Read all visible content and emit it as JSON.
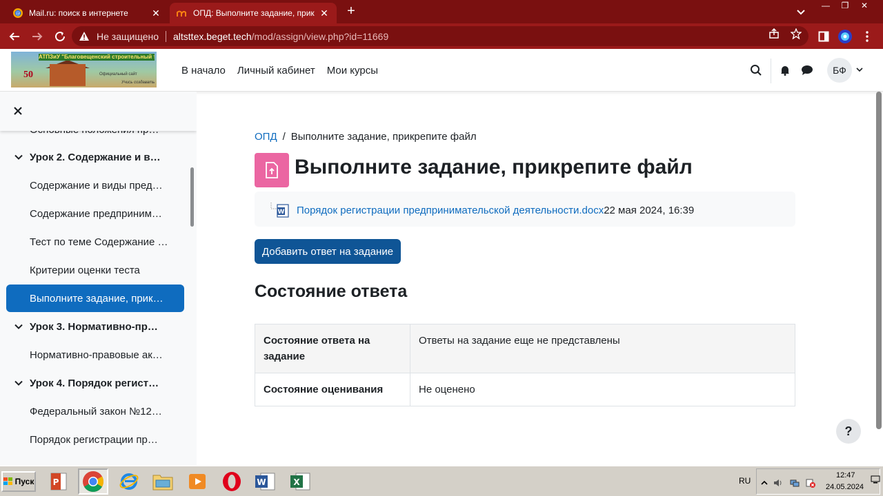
{
  "browser": {
    "tabs": [
      {
        "title": "Mail.ru: поиск в интернете",
        "active": false
      },
      {
        "title": "ОПД: Выполните задание, прикреп",
        "active": true
      }
    ],
    "address": {
      "security_label": "Не защищено",
      "host": "altsttex.beget.tech",
      "path": "/mod/assign/view.php?id=11669"
    }
  },
  "header": {
    "logo": {
      "banner": "АТПЗиУ \"Благовещенский строительный техникум\"",
      "number": "50",
      "slogan": "Официальный сайт",
      "slogan2": "Учись создавать"
    },
    "nav": [
      "В начало",
      "Личный кабинет",
      "Мои курсы"
    ],
    "user_initials": "БФ"
  },
  "course_index": [
    {
      "type": "item",
      "label": "Основные положения пр…",
      "active": false
    },
    {
      "type": "section",
      "label": "Урок 2. Содержание и в…"
    },
    {
      "type": "item",
      "label": "Содержание и виды пред…",
      "active": false
    },
    {
      "type": "item",
      "label": "Содержание предприним…",
      "active": false
    },
    {
      "type": "item",
      "label": "Тест по теме Содержание …",
      "active": false
    },
    {
      "type": "item",
      "label": "Критерии оценки теста",
      "active": false
    },
    {
      "type": "item",
      "label": "Выполните задание, прик…",
      "active": true
    },
    {
      "type": "section",
      "label": "Урок 3. Нормативно-пр…"
    },
    {
      "type": "item",
      "label": "Нормативно-правовые ак…",
      "active": false
    },
    {
      "type": "section",
      "label": "Урок 4. Порядок регист…"
    },
    {
      "type": "item",
      "label": "Федеральный закон №12…",
      "active": false
    },
    {
      "type": "item",
      "label": "Порядок регистрации пр…",
      "active": false
    }
  ],
  "main": {
    "breadcrumb": {
      "course": "ОПД",
      "separator": "/",
      "current": "Выполните задание, прикрепите файл"
    },
    "title": "Выполните задание, прикрепите файл",
    "attachment": {
      "filename": "Порядок регистрации предпринимательской деятельности.docx",
      "date": "22 мая 2024, 16:39"
    },
    "add_button": "Добавить ответ на задание",
    "status_heading": "Состояние ответа",
    "status_table": [
      {
        "label": "Состояние ответа на задание",
        "value": "Ответы на задание еще не представлены"
      },
      {
        "label": "Состояние оценивания",
        "value": "Не оценено"
      }
    ],
    "help": "?"
  },
  "taskbar": {
    "start_label": "Пуск",
    "language": "RU",
    "time": "12:47",
    "date": "24.05.2024"
  },
  "colors": {
    "browser_frame": "#7a1010",
    "toolbar": "#9b1a1a",
    "brand_blue": "#0f6cbf",
    "button_blue": "#0f5596",
    "activity_pink": "#eb66a2"
  }
}
